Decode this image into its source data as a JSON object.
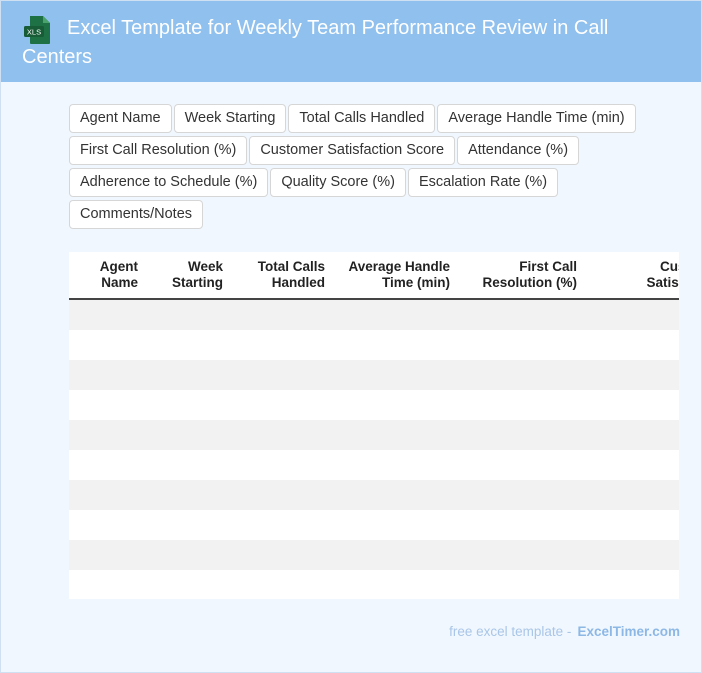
{
  "page": {
    "title": "Excel Template for Weekly Team Performance Review in Call Centers",
    "icon": "xls-file-icon",
    "icon_label": "XLS"
  },
  "fields": [
    "Agent Name",
    "Week Starting",
    "Total Calls Handled",
    "Average Handle Time (min)",
    "First Call Resolution (%)",
    "Customer Satisfaction Score",
    "Attendance (%)",
    "Adherence to Schedule (%)",
    "Quality Score (%)",
    "Escalation Rate (%)",
    "Comments/Notes"
  ],
  "table": {
    "headers": [
      "Agent Name",
      "Week Starting",
      "Total Calls Handled",
      "Average Handle Time (min)",
      "First Call Resolution (%)",
      "Customer Satisfaction"
    ],
    "empty_rows": 10
  },
  "footer": {
    "text": "free excel template -",
    "brand": "ExcelTimer.com"
  },
  "colors": {
    "header_bg": "#8fc0ee",
    "page_bg": "#f1f7fe",
    "icon_green": "#1e7145",
    "stripe": "#f2f2f2"
  }
}
